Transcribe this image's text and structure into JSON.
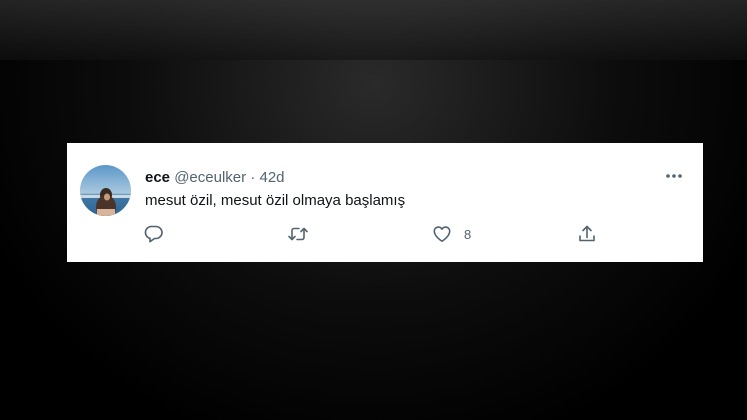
{
  "tweet": {
    "display_name": "ece",
    "handle": "@eceulker",
    "separator": "·",
    "time": "42d",
    "text": "mesut özil, mesut özil olmaya başlamış",
    "like_count": "8"
  },
  "icons": {
    "more": "more-horizontal-icon",
    "reply": "reply-icon",
    "retweet": "retweet-icon",
    "like": "heart-icon",
    "share": "share-icon"
  },
  "colors": {
    "text_primary": "#0f1419",
    "text_secondary": "#536471",
    "card_background": "#ffffff"
  }
}
